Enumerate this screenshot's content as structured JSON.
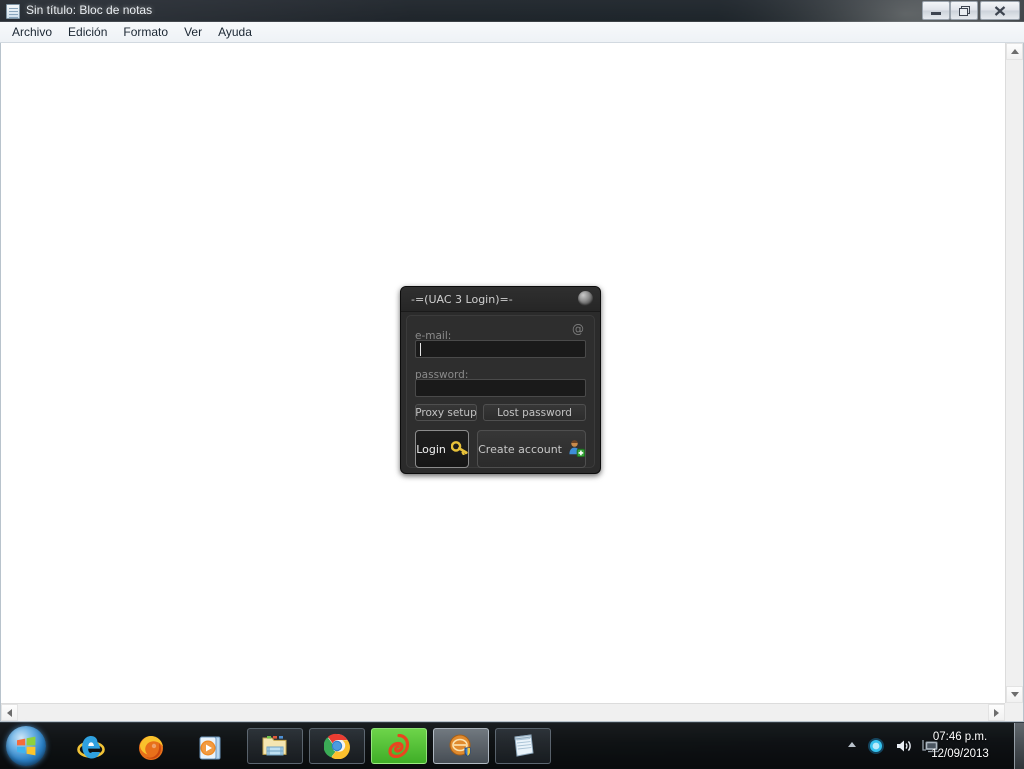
{
  "desktop": {
    "wallpaper_tone": "#141a1e"
  },
  "notepad_window": {
    "title": "Sin título: Bloc de notas",
    "icon": "notepad-icon",
    "window_buttons": {
      "minimize": "minimize-icon",
      "maximize": "restore-icon",
      "close": "close-icon"
    },
    "menubar": [
      {
        "label": "Archivo"
      },
      {
        "label": "Edición"
      },
      {
        "label": "Formato"
      },
      {
        "label": "Ver"
      },
      {
        "label": "Ayuda"
      }
    ],
    "document_text": "",
    "scrollbars": {
      "vertical_up": "scroll-up-icon",
      "vertical_down": "scroll-down-icon",
      "horizontal_left": "scroll-left-icon",
      "horizontal_right": "scroll-right-icon"
    }
  },
  "uac_dialog": {
    "title": "-=(UAC 3 Login)=-",
    "titlebar_orb": "sphere-icon",
    "email": {
      "label": "e-mail:",
      "value": "",
      "placeholder": "",
      "adornment_icon": "at-icon"
    },
    "password": {
      "label": "password:",
      "value": "",
      "placeholder": ""
    },
    "secondary_buttons": [
      {
        "label": "Proxy setup",
        "name": "proxy-setup-button"
      },
      {
        "label": "Lost password",
        "name": "lost-password-button"
      }
    ],
    "primary_buttons": [
      {
        "label": "Login",
        "icon": "key-icon",
        "name": "login-button"
      },
      {
        "label": "Create account",
        "icon": "add-user-icon",
        "name": "create-account-button"
      }
    ],
    "colors": {
      "background": "#2b2b2b",
      "panel": "#2e2e2e",
      "field": "#1a1a1a",
      "text": "#c2c2c2",
      "muted_text": "#8b8b8b"
    }
  },
  "taskbar": {
    "start_button": "windows-start-orb-icon",
    "quick_launch": [
      {
        "name": "internet-explorer-icon",
        "label": "Internet Explorer"
      },
      {
        "name": "firefox-icon",
        "label": "Mozilla Firefox"
      },
      {
        "name": "windows-media-player-icon",
        "label": "Windows Media Player"
      }
    ],
    "task_buttons": [
      {
        "name": "windows-explorer-icon",
        "label": "Explorador de Windows"
      },
      {
        "name": "google-chrome-icon",
        "label": "Google Chrome"
      },
      {
        "name": "origin-icon",
        "label": "Origin"
      },
      {
        "name": "security-shield-icon",
        "label": "Security"
      },
      {
        "name": "notepad-icon",
        "label": "Bloc de notas"
      }
    ],
    "tray": {
      "overflow": "show-hidden-icons-arrow",
      "icons": [
        {
          "name": "action-center-icon"
        },
        {
          "name": "volume-icon"
        },
        {
          "name": "network-icon"
        }
      ],
      "clock": {
        "time": "07:46 p.m.",
        "date": "12/09/2013"
      },
      "show_desktop": "show-desktop-button"
    }
  }
}
